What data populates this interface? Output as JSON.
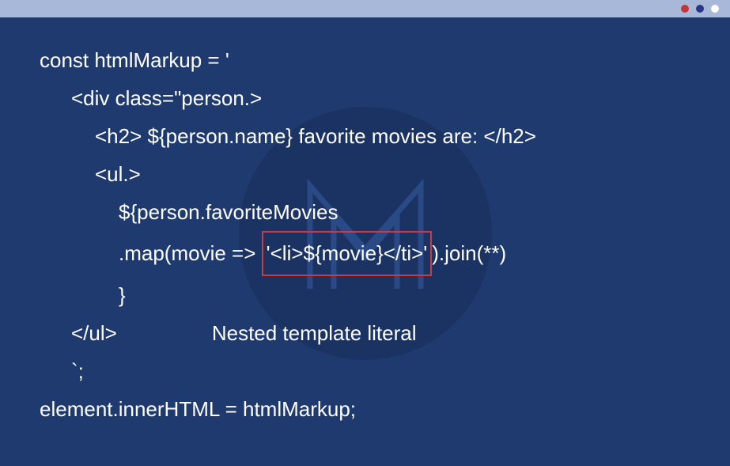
{
  "titlebar": {
    "dots": [
      "red",
      "blue",
      "white"
    ]
  },
  "code": {
    "l1": "const htmlMarkup = '",
    "l2": "<div class=\"person.>",
    "l3": "<h2> ${person.name} favorite movies are: </h2>",
    "l4": "<ul.>",
    "l5": "${person.favoriteMovies",
    "l6a": ".map(movie => ",
    "l6b": "'<li>${movie}</ti>'",
    "l6c": ").join(**)",
    "l7": "}",
    "l8a": "</ul>",
    "l8gap": "                ",
    "l8b": "Nested template literal",
    "l9": "`;",
    "l10": "element.innerHTML = htmlMarkup;"
  }
}
